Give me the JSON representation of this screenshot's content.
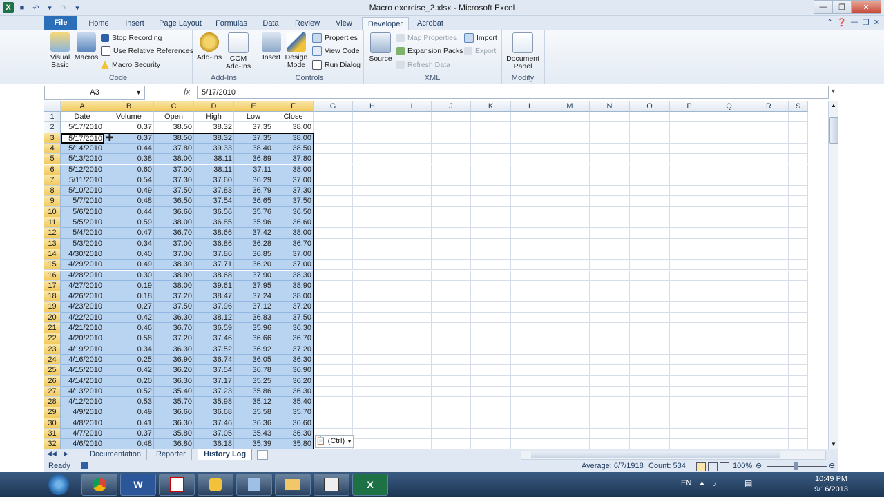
{
  "window": {
    "title": "Macro exercise_2.xlsx - Microsoft Excel",
    "app_icon": "X"
  },
  "tabs": [
    "File",
    "Home",
    "Insert",
    "Page Layout",
    "Formulas",
    "Data",
    "Review",
    "View",
    "Developer",
    "Acrobat"
  ],
  "active_tab": "Developer",
  "ribbon": {
    "code": {
      "label": "Code",
      "visual_basic": "Visual\nBasic",
      "macros": "Macros",
      "stop_recording": "Stop Recording",
      "relative_refs": "Use Relative References",
      "macro_security": "Macro Security"
    },
    "addins": {
      "label": "Add-Ins",
      "add_ins": "Add-Ins",
      "com_add_ins": "COM\nAdd-Ins"
    },
    "controls": {
      "label": "Controls",
      "insert": "Insert",
      "design_mode": "Design\nMode",
      "properties": "Properties",
      "view_code": "View Code",
      "run_dialog": "Run Dialog"
    },
    "xml": {
      "label": "XML",
      "source": "Source",
      "map_properties": "Map Properties",
      "expansion_packs": "Expansion Packs",
      "refresh_data": "Refresh Data",
      "import": "Import",
      "export": "Export"
    },
    "modify": {
      "label": "Modify",
      "document_panel": "Document\nPanel"
    }
  },
  "formula_bar": {
    "name_box": "A3",
    "fx": "fx",
    "value": "5/17/2010"
  },
  "columns": [
    "A",
    "B",
    "C",
    "D",
    "E",
    "F",
    "G",
    "H",
    "I",
    "J",
    "K",
    "L",
    "M",
    "N",
    "O",
    "P",
    "Q",
    "R",
    "S"
  ],
  "headers": [
    "Date",
    "Volume",
    "Open",
    "High",
    "Low",
    "Close"
  ],
  "rows": [
    [
      "5/17/2010",
      "0.37",
      "38.50",
      "38.32",
      "37.35",
      "38.00"
    ],
    [
      "5/17/2010",
      "0.37",
      "38.50",
      "38.32",
      "37.35",
      "38.00"
    ],
    [
      "5/14/2010",
      "0.44",
      "37.80",
      "39.33",
      "38.40",
      "38.50"
    ],
    [
      "5/13/2010",
      "0.38",
      "38.00",
      "38.11",
      "36.89",
      "37.80"
    ],
    [
      "5/12/2010",
      "0.60",
      "37.00",
      "38.11",
      "37.11",
      "38.00"
    ],
    [
      "5/11/2010",
      "0.54",
      "37.30",
      "37.60",
      "36.29",
      "37.00"
    ],
    [
      "5/10/2010",
      "0.49",
      "37.50",
      "37.83",
      "36.79",
      "37.30"
    ],
    [
      "5/7/2010",
      "0.48",
      "36.50",
      "37.54",
      "36.65",
      "37.50"
    ],
    [
      "5/6/2010",
      "0.44",
      "36.60",
      "36.56",
      "35.76",
      "36.50"
    ],
    [
      "5/5/2010",
      "0.59",
      "38.00",
      "36.85",
      "35.96",
      "36.60"
    ],
    [
      "5/4/2010",
      "0.47",
      "36.70",
      "38.66",
      "37.42",
      "38.00"
    ],
    [
      "5/3/2010",
      "0.34",
      "37.00",
      "36.86",
      "36.28",
      "36.70"
    ],
    [
      "4/30/2010",
      "0.40",
      "37.00",
      "37.86",
      "36.85",
      "37.00"
    ],
    [
      "4/29/2010",
      "0.49",
      "38.30",
      "37.71",
      "36.20",
      "37.00"
    ],
    [
      "4/28/2010",
      "0.30",
      "38.90",
      "38.68",
      "37.90",
      "38.30"
    ],
    [
      "4/27/2010",
      "0.19",
      "38.00",
      "39.61",
      "37.95",
      "38.90"
    ],
    [
      "4/26/2010",
      "0.18",
      "37.20",
      "38.47",
      "37.24",
      "38.00"
    ],
    [
      "4/23/2010",
      "0.27",
      "37.50",
      "37.96",
      "37.12",
      "37.20"
    ],
    [
      "4/22/2010",
      "0.42",
      "36.30",
      "38.12",
      "36.83",
      "37.50"
    ],
    [
      "4/21/2010",
      "0.46",
      "36.70",
      "36.59",
      "35.96",
      "36.30"
    ],
    [
      "4/20/2010",
      "0.58",
      "37.20",
      "37.46",
      "36.66",
      "36.70"
    ],
    [
      "4/19/2010",
      "0.34",
      "36.30",
      "37.52",
      "36.92",
      "37.20"
    ],
    [
      "4/16/2010",
      "0.25",
      "36.90",
      "36.74",
      "36.05",
      "36.30"
    ],
    [
      "4/15/2010",
      "0.42",
      "36.20",
      "37.54",
      "36.78",
      "36.90"
    ],
    [
      "4/14/2010",
      "0.20",
      "36.30",
      "37.17",
      "35.25",
      "36.20"
    ],
    [
      "4/13/2010",
      "0.52",
      "35.40",
      "37.23",
      "35.86",
      "36.30"
    ],
    [
      "4/12/2010",
      "0.53",
      "35.70",
      "35.98",
      "35.12",
      "35.40"
    ],
    [
      "4/9/2010",
      "0.49",
      "36.60",
      "36.68",
      "35.58",
      "35.70"
    ],
    [
      "4/8/2010",
      "0.41",
      "36.30",
      "37.46",
      "36.36",
      "36.60"
    ],
    [
      "4/7/2010",
      "0.37",
      "35.80",
      "37.05",
      "35.43",
      "36.30"
    ],
    [
      "4/6/2010",
      "0.48",
      "36.80",
      "36.18",
      "35.39",
      "35.80"
    ]
  ],
  "sheet_tabs": [
    "Documentation",
    "Reporter",
    "History Log"
  ],
  "active_sheet": "History Log",
  "paste_options": "(Ctrl)",
  "status": {
    "ready": "Ready",
    "average": "Average: 6/7/1918",
    "count": "Count: 534",
    "zoom": "100%"
  },
  "taskbar": {
    "lang": "EN",
    "time": "10:49 PM",
    "date": "9/16/2013",
    "apps": [
      "W",
      "X"
    ]
  }
}
